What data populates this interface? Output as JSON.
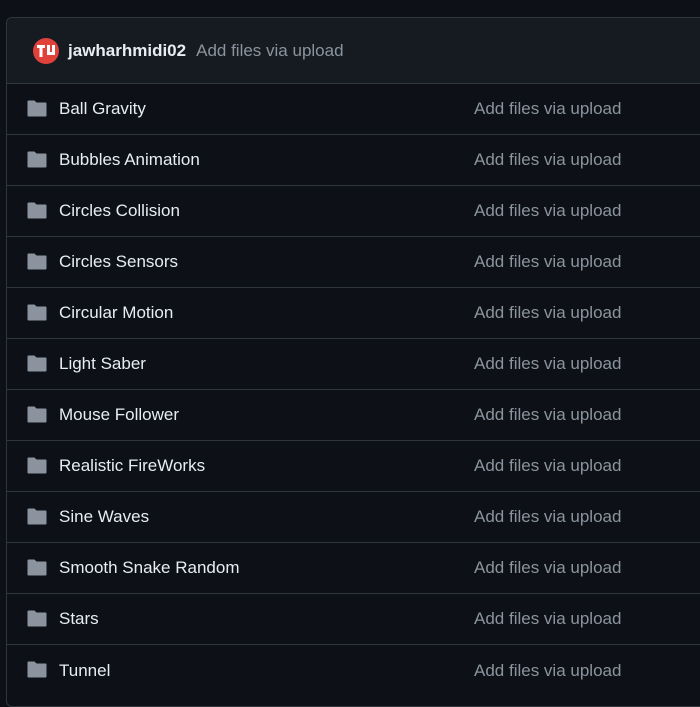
{
  "header": {
    "author": "jawharhmidi02",
    "message": "Add files via upload"
  },
  "colors": {
    "background": "#0d1117",
    "header_bg": "#161b22",
    "border": "#30363d",
    "text": "#e6edf3",
    "muted": "#8b949e",
    "folder": "#8b949e",
    "avatar": "#e0413b"
  },
  "entries": [
    {
      "name": "Ball Gravity",
      "icon": "folder-icon",
      "message": "Add files via upload"
    },
    {
      "name": "Bubbles Animation",
      "icon": "folder-icon",
      "message": "Add files via upload"
    },
    {
      "name": "Circles Collision",
      "icon": "folder-icon",
      "message": "Add files via upload"
    },
    {
      "name": "Circles Sensors",
      "icon": "folder-icon",
      "message": "Add files via upload"
    },
    {
      "name": "Circular Motion",
      "icon": "folder-icon",
      "message": "Add files via upload"
    },
    {
      "name": "Light Saber",
      "icon": "folder-icon",
      "message": "Add files via upload"
    },
    {
      "name": "Mouse Follower",
      "icon": "folder-icon",
      "message": "Add files via upload"
    },
    {
      "name": "Realistic FireWorks",
      "icon": "folder-icon",
      "message": "Add files via upload"
    },
    {
      "name": "Sine Waves",
      "icon": "folder-icon",
      "message": "Add files via upload"
    },
    {
      "name": "Smooth Snake Random",
      "icon": "folder-icon",
      "message": "Add files via upload"
    },
    {
      "name": "Stars",
      "icon": "folder-icon",
      "message": "Add files via upload"
    },
    {
      "name": "Tunnel",
      "icon": "folder-icon",
      "message": "Add files via upload"
    }
  ]
}
